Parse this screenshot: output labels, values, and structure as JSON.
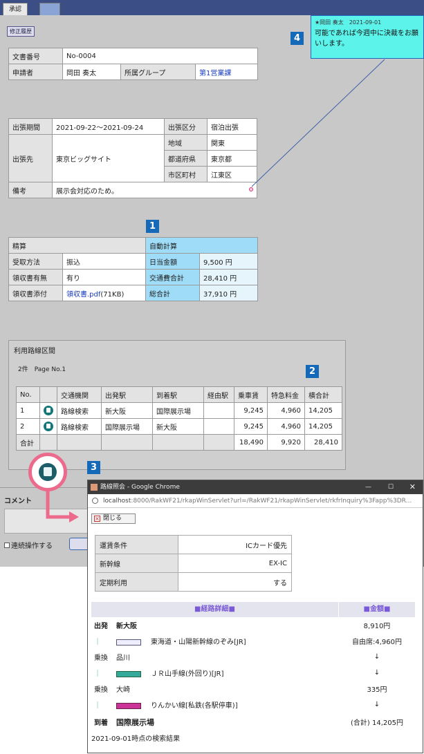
{
  "tabs": {
    "approval": "承認"
  },
  "revision_button": "修正履歴",
  "doc": {
    "number_label": "文書番号",
    "number": "No-0004",
    "applicant_label": "申請者",
    "applicant": "岡田 奏太",
    "group_label": "所属グループ",
    "group": "第1営業課"
  },
  "trip": {
    "period_label": "出張期間",
    "period": "2021-09-22～2021-09-24",
    "type_label": "出張区分",
    "type": "宿泊出張",
    "dest_label": "出張先",
    "dest": "東京ビッグサイト",
    "region_label": "地域",
    "region": "関東",
    "pref_label": "都道府県",
    "pref": "東京都",
    "city_label": "市区町村",
    "city": "江東区",
    "remark_label": "備考",
    "remark": "展示会対応のため。"
  },
  "settle": {
    "title": "精算",
    "auto": "自動計算",
    "recv_label": "受取方法",
    "recv": "振込",
    "daily_label": "日当金額",
    "daily": "9,500 円",
    "receipt_label": "領収書有無",
    "receipt": "有り",
    "transport_label": "交通費合計",
    "transport": "28,410 円",
    "attach_label": "領収書添付",
    "attach": "領収書.pdf",
    "attach_size": "(71KB)",
    "total_label": "総合計",
    "total": "37,910 円"
  },
  "note": {
    "header": "★岡田 奏太　2021-09-01",
    "body": "可能であれば今週中に決裁をお願いします。"
  },
  "badges": {
    "b1": "1",
    "b2": "2",
    "b3": "3",
    "b4": "4"
  },
  "route": {
    "title": "利用路線区間",
    "count": "2件　Page No.1",
    "headers": [
      "No.",
      "",
      "交通機関",
      "出発駅",
      "到着駅",
      "経由駅",
      "乗車賃",
      "特急料金",
      "横合計"
    ],
    "rows": [
      {
        "no": "1",
        "kind": "路線検索",
        "from": "新大阪",
        "to": "国際展示場",
        "via": "",
        "fare": "9,245",
        "express": "4,960",
        "sum": "14,205"
      },
      {
        "no": "2",
        "kind": "路線検索",
        "from": "国際展示場",
        "to": "新大阪",
        "via": "",
        "fare": "9,245",
        "express": "4,960",
        "sum": "14,205"
      }
    ],
    "total_label": "合計",
    "total_fare": "18,490",
    "total_express": "9,920",
    "total_sum": "28,410"
  },
  "comment": {
    "label": "コメント",
    "continuous": "連続操作する"
  },
  "popup": {
    "title": "路線照会 - Google Chrome",
    "url_host": "localhost",
    "url_rest": ":8000/RakWF21/rkapWinServlet?url=/RakWF21/rkapWinServlet/rkfrInquiry%3Fapp%3DR...",
    "close": "閉じる",
    "cond": [
      {
        "label": "運賃条件",
        "value": "ICカード優先"
      },
      {
        "label": "新幹線",
        "value": "EX-IC"
      },
      {
        "label": "定期利用",
        "value": "する"
      }
    ],
    "detail_head": "■経路詳細■",
    "amount_head": "■金額■",
    "steps": [
      {
        "a": "出発",
        "b": "新大阪",
        "c": "8,910円",
        "bold": true
      },
      {
        "a": "｜",
        "b": "東海道・山陽新幹線のぞみ[JR]",
        "c": "自由席:4,960円",
        "train": "#e8e8ff"
      },
      {
        "a": "乗換",
        "b": "品川",
        "c": "↓"
      },
      {
        "a": "｜",
        "b": "ＪＲ山手線(外回り)[JR]",
        "c": "↓",
        "train": "#3a9"
      },
      {
        "a": "乗換",
        "b": "大崎",
        "c": "335円"
      },
      {
        "a": "｜",
        "b": "りんかい線[私鉄(各駅停車)]",
        "c": "↓",
        "train": "#c39"
      },
      {
        "a": "到着",
        "b": "国際展示場",
        "c": "(合計) 14,205円",
        "bold": true
      }
    ],
    "footer": "2021-09-01時点の検索結果"
  }
}
